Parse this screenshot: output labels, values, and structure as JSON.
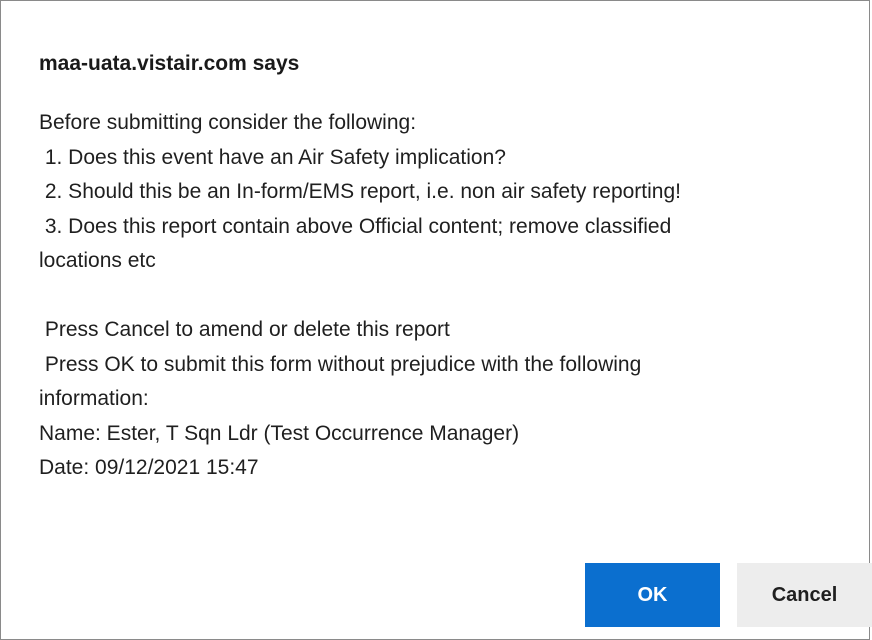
{
  "dialog": {
    "title": "maa-uata.vistair.com says",
    "message_lines": [
      "Before submitting consider the following:",
      " 1. Does this event have an Air Safety implication?",
      " 2. Should this be an In-form/EMS report, i.e. non air safety reporting!",
      " 3. Does this report contain above Official content; remove classified",
      "locations etc",
      "",
      " Press Cancel to amend or delete this report",
      " Press OK to submit this form without prejudice with the following",
      "information:",
      "Name: Ester, T Sqn Ldr (Test Occurrence Manager)",
      "Date: 09/12/2021 15:47"
    ],
    "ok_label": "OK",
    "cancel_label": "Cancel"
  },
  "colors": {
    "ok_button_bg": "#0b6fcf",
    "cancel_button_bg": "#ededed"
  }
}
